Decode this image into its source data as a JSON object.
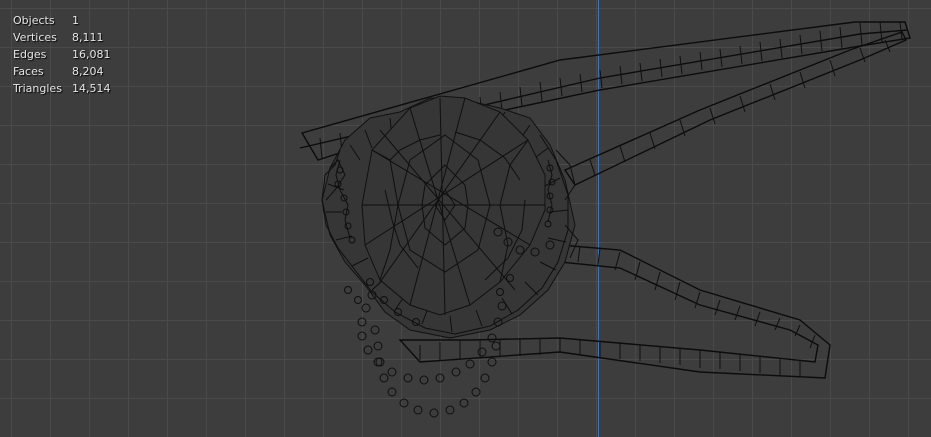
{
  "viewport": {
    "name": "3D Viewport",
    "mode": "wireframe"
  },
  "stats": [
    {
      "label": "Objects",
      "value": "1"
    },
    {
      "label": "Vertices",
      "value": "8,111"
    },
    {
      "label": "Edges",
      "value": "16,081"
    },
    {
      "label": "Faces",
      "value": "8,204"
    },
    {
      "label": "Triangles",
      "value": "14,514"
    }
  ],
  "colors": {
    "background": "#3d3d3d",
    "grid": "#4a4a4a",
    "axis_y": "#3f73b8",
    "wire": "#0f0f0f"
  }
}
